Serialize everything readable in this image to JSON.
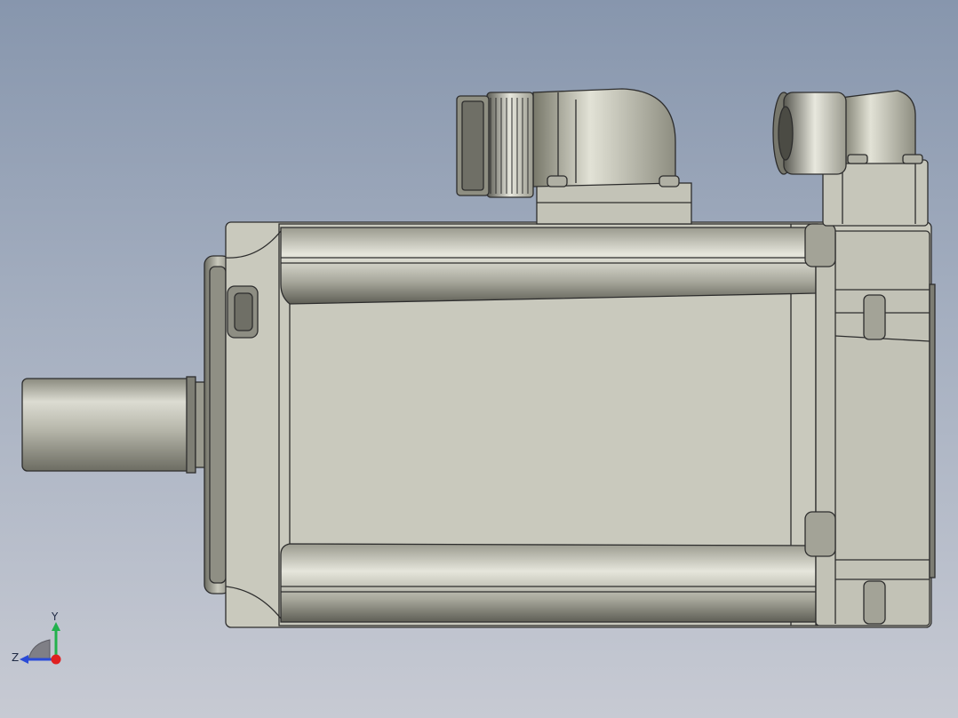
{
  "viewport": {
    "background_top": "#8796ad",
    "background_bottom": "#c7cad3",
    "body_color": "#c9c9bd",
    "edge_color": "#2d2d2d"
  },
  "triad": {
    "y_label": "Y",
    "z_label": "Z",
    "y_color": "#22b14c",
    "z_color": "#2a4bd7",
    "origin_color": "#e02020"
  }
}
